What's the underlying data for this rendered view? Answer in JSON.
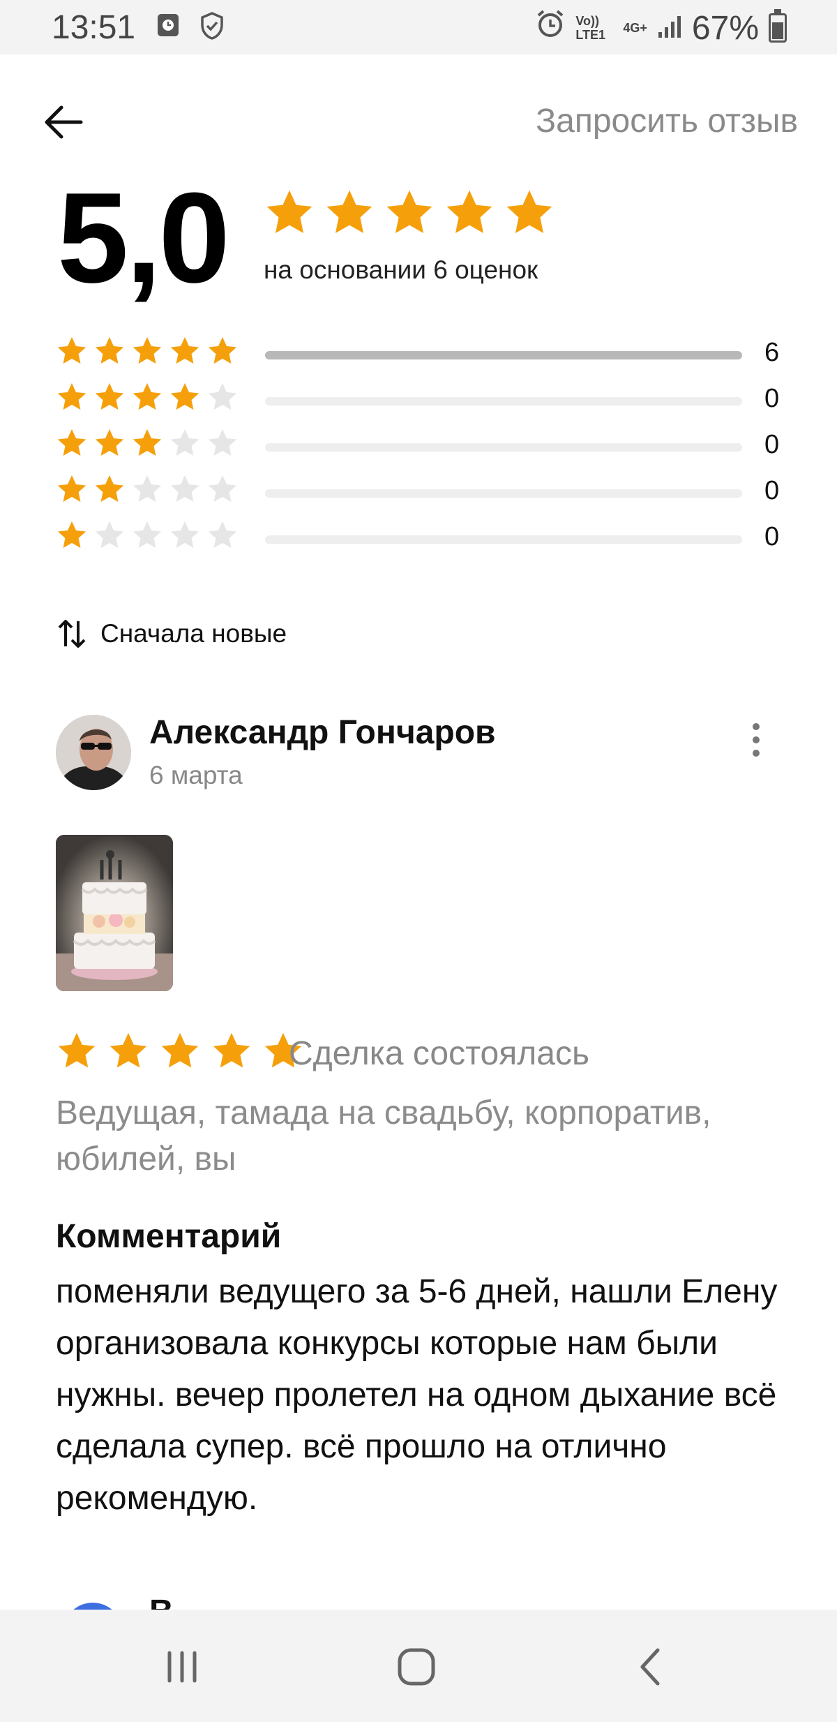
{
  "status_bar": {
    "time": "13:51",
    "network_label": "Vo)) LTE1",
    "network_type": "4G+",
    "battery": "67%",
    "icons": [
      "alarm-app-icon",
      "shield-icon",
      "alarm-clock-icon",
      "signal-icon",
      "battery-icon"
    ]
  },
  "header": {
    "back_icon": "arrow-left-icon",
    "request_review": "Запросить отзыв"
  },
  "summary": {
    "score": "5,0",
    "score_value": 5.0,
    "stars_filled": 5,
    "caption": "на основании 6 оценок"
  },
  "distribution": [
    {
      "stars": 5,
      "count": "6",
      "fraction": 1.0
    },
    {
      "stars": 4,
      "count": "0",
      "fraction": 0
    },
    {
      "stars": 3,
      "count": "0",
      "fraction": 0
    },
    {
      "stars": 2,
      "count": "0",
      "fraction": 0
    },
    {
      "stars": 1,
      "count": "0",
      "fraction": 0
    }
  ],
  "sort": {
    "icon": "sort-arrows-icon",
    "label": "Сначала новые"
  },
  "review": {
    "name": "Александр Гончаров",
    "date": "6 марта",
    "rating": 5,
    "status": "Сделка состоялась",
    "service": "Ведущая, тамада на свадьбу, корпоратив, юбилей, вы",
    "comment_title": "Комментарий",
    "comment": "поменяли ведущего за 5-6 дней, нашли Елену организовала конкурсы которые нам были нужны. вечер пролетел на одном дыхание всё сделала супер. всё прошло на отлично рекомендую."
  },
  "next_review": {
    "name_partial": "В"
  },
  "colors": {
    "star_active": "#f5a00b",
    "star_inactive": "#e6e6e6",
    "muted_text": "#888888",
    "bar_fill": "#b8b8b8",
    "bar_track": "#eeeeee"
  },
  "nav": {
    "icons": [
      "recent-apps-icon",
      "home-icon",
      "back-icon"
    ]
  }
}
